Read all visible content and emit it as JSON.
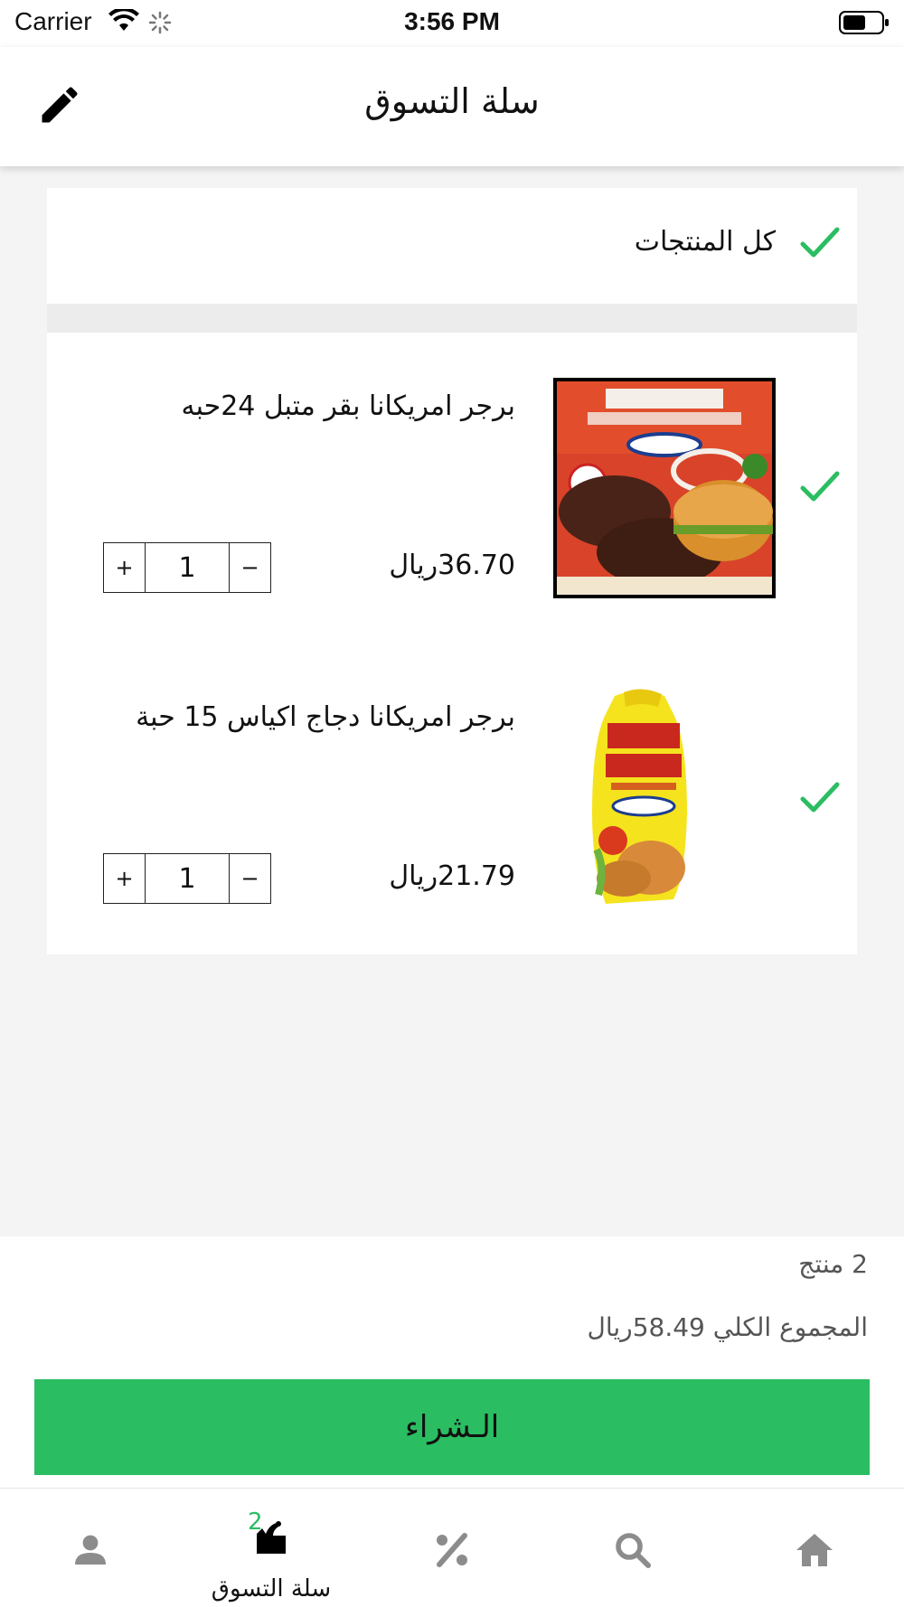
{
  "status_bar": {
    "carrier": "Carrier",
    "time": "3:56 PM"
  },
  "nav": {
    "title": "سلة التسوق",
    "edit_icon": "pencil-icon"
  },
  "select_all": {
    "label": "كل المنتجات",
    "checked": true
  },
  "products": [
    {
      "name": "برجر امريكانا بقر متبل 24حبه",
      "price": "36.70ريال",
      "quantity": "1",
      "checked": true,
      "plus": "+",
      "minus": "−"
    },
    {
      "name": "برجر امريكانا دجاج اكياس 15 حبة",
      "price": "21.79ريال",
      "quantity": "1",
      "checked": true,
      "plus": "+",
      "minus": "−"
    }
  ],
  "summary": {
    "count": "2 منتج",
    "total": "المجموع الكلي 58.49ريال",
    "buy_label": "الـشراء"
  },
  "tab_bar": {
    "items": [
      {
        "icon": "person-icon",
        "label": ""
      },
      {
        "icon": "cart-icon",
        "label": "سلة التسوق",
        "badge": "2",
        "active": true
      },
      {
        "icon": "percent-icon",
        "label": ""
      },
      {
        "icon": "search-icon",
        "label": ""
      },
      {
        "icon": "home-icon",
        "label": ""
      }
    ]
  },
  "colors": {
    "accent_green": "#2bbd62",
    "icon_gray": "#8c8c8c",
    "background": "#f4f4f4"
  }
}
